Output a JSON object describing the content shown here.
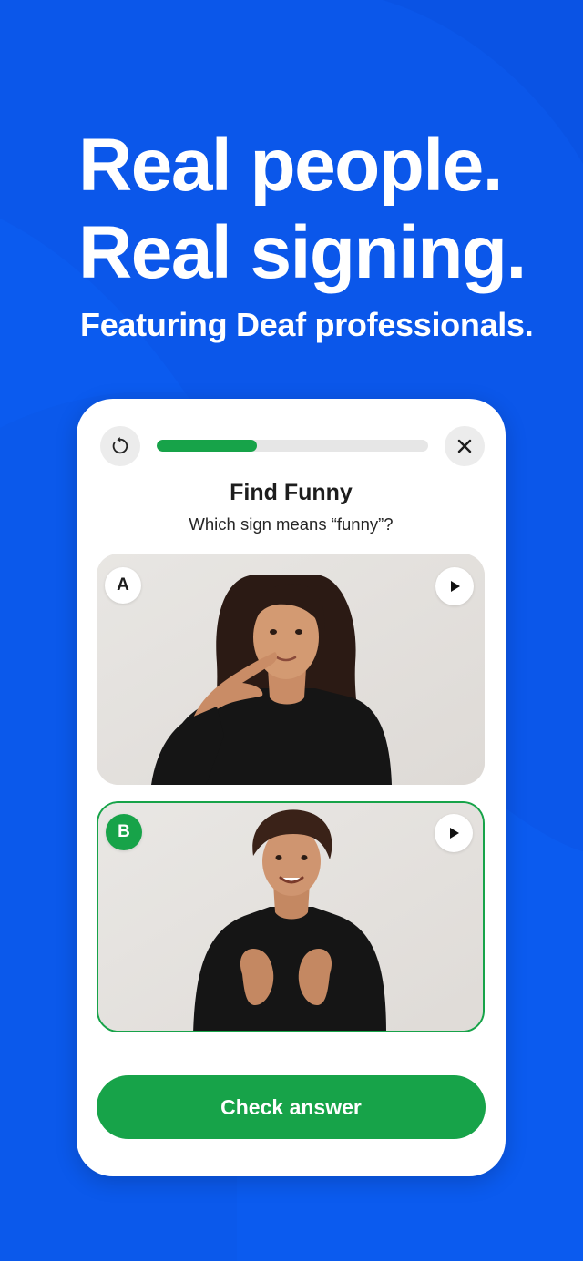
{
  "headline": {
    "line1": "Real people.",
    "line2": "Real signing.",
    "subtitle": "Featuring Deaf professionals."
  },
  "quiz": {
    "progress": 0.37,
    "title": "Find Funny",
    "question": "Which sign means “funny”?",
    "options": [
      {
        "letter": "A",
        "selected": false
      },
      {
        "letter": "B",
        "selected": true
      }
    ],
    "check_label": "Check answer"
  },
  "icons": {
    "restart": "restart-icon",
    "close": "close-icon",
    "play": "play-icon"
  },
  "colors": {
    "background": "#0a55e6",
    "accent_green": "#17a349",
    "card": "#ffffff"
  }
}
